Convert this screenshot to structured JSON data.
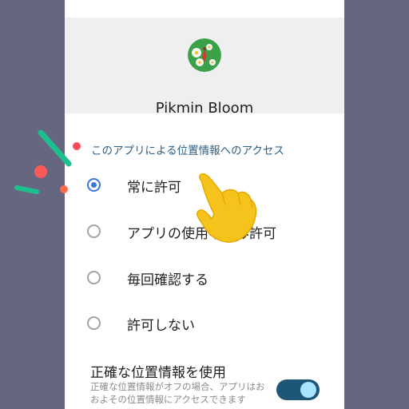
{
  "app": {
    "name": "Pikmin Bloom",
    "icon": "pikmin-flower-icon"
  },
  "location_access": {
    "section_title": "このアプリによる位置情報へのアクセス",
    "options": [
      {
        "label": "常に許可",
        "selected": true
      },
      {
        "label": "アプリの使用中のみ許可",
        "selected": false
      },
      {
        "label": "毎回確認する",
        "selected": false
      },
      {
        "label": "許可しない",
        "selected": false
      }
    ]
  },
  "precise_location": {
    "title": "正確な位置情報を使用",
    "description": "正確な位置情報がオフの場合、アプリはおおよその位置情報にアクセスできます",
    "enabled": true
  },
  "colors": {
    "background": "#676680",
    "accent": "#3c79d4",
    "section_title": "#2a5f86",
    "toggle_track": "#1e5677",
    "toggle_knob": "#a8e3ff",
    "sparkle_green": "#1dbf8f",
    "sparkle_red": "#ff5a5a",
    "hand_yellow": "#f6c21c"
  }
}
